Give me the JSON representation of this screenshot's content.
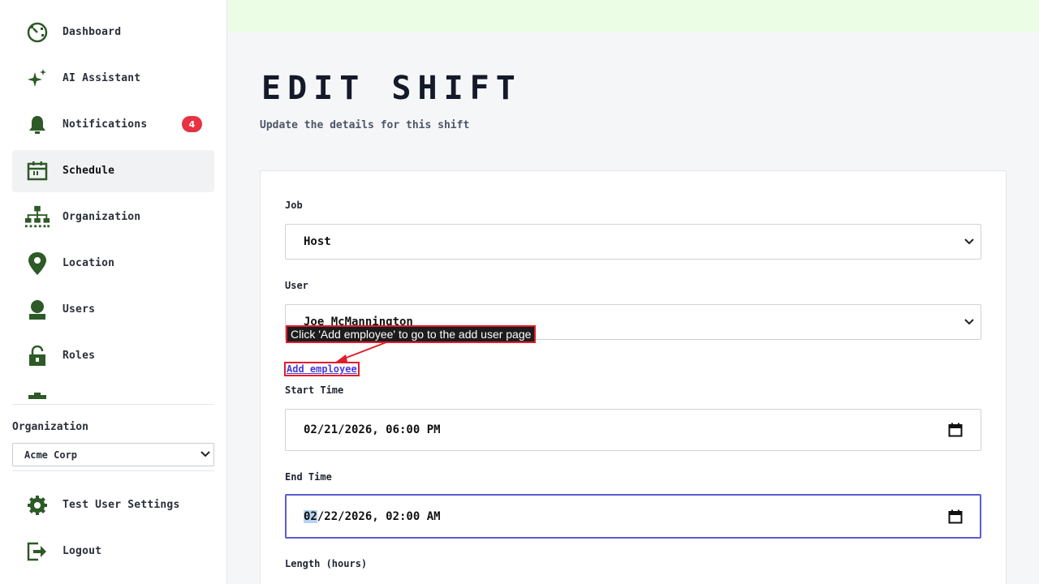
{
  "sidebar": {
    "items": [
      {
        "label": "Dashboard",
        "icon": "dashboard-icon"
      },
      {
        "label": "AI Assistant",
        "icon": "sparkle-icon"
      },
      {
        "label": "Notifications",
        "icon": "bell-icon",
        "badge": "4"
      },
      {
        "label": "Schedule",
        "icon": "calendar-icon",
        "active": true
      },
      {
        "label": "Organization",
        "icon": "org-chart-icon"
      },
      {
        "label": "Location",
        "icon": "location-pin-icon"
      },
      {
        "label": "Users",
        "icon": "user-icon"
      },
      {
        "label": "Roles",
        "icon": "lock-icon"
      }
    ],
    "organization_label": "Organization",
    "organization_value": "Acme Corp",
    "settings_label": "Test User Settings",
    "logout_label": "Logout"
  },
  "page": {
    "title": "EDIT SHIFT",
    "subtitle": "Update the details for this shift"
  },
  "form": {
    "job_label": "Job",
    "job_value": "Host",
    "user_label": "User",
    "user_value": "Joe McMannington",
    "add_employee_link": "Add employee",
    "start_label": "Start Time",
    "start_value_rest": "02/21/2026, 06:00 PM",
    "end_label": "End Time",
    "end_value_month": "02",
    "end_value_rest": "/22/2026, 02:00 AM",
    "length_label": "Length (hours)"
  },
  "annotation": {
    "tooltip": "Click 'Add employee' to go to the add user page"
  },
  "colors": {
    "icon_green": "#2d5a27",
    "badge_red": "#e63241",
    "topbar": "#ecfde6",
    "focus": "#5b5bd6",
    "link": "#4b3bd8"
  }
}
